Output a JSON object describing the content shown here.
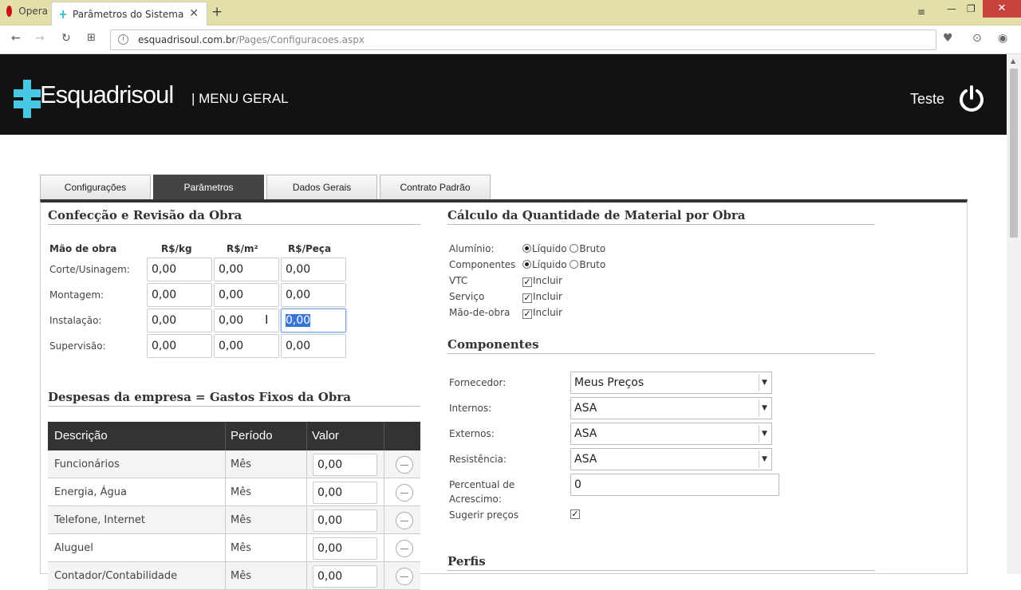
{
  "browser": {
    "opera_label": "Opera",
    "tab_title": "Parâmetros do Sistema",
    "url_host": "esquadrisoul.com.br",
    "url_path": "/Pages/Configuracoes.aspx"
  },
  "header": {
    "logo": "Esquadrisoul",
    "menu": "| MENU GERAL",
    "user": "Teste"
  },
  "tabs": [
    "Configurações",
    "Parâmetros",
    "Dados Gerais",
    "Contrato Padrão"
  ],
  "confeccao": {
    "title": "Confecção e Revisão da Obra",
    "col_labor": "Mão de obra",
    "col_kg": "R$/kg",
    "col_m2": "R$/m²",
    "col_peca": "R$/Peça",
    "rows": [
      {
        "label": "Corte/Usinagem:",
        "kg": "0,00",
        "m2": "0,00",
        "peca": "0,00"
      },
      {
        "label": "Montagem:",
        "kg": "0,00",
        "m2": "0,00",
        "peca": "0,00"
      },
      {
        "label": "Instalação:",
        "kg": "0,00",
        "m2": "0,00",
        "peca": "0,00"
      },
      {
        "label": "Supervisão:",
        "kg": "0,00",
        "m2": "0,00",
        "peca": "0,00"
      }
    ]
  },
  "despesas": {
    "title": "Despesas da empresa = Gastos Fixos da Obra",
    "headers": {
      "desc": "Descrição",
      "periodo": "Período",
      "valor": "Valor"
    },
    "rows": [
      {
        "desc": "Funcionários",
        "periodo": "Mês",
        "valor": "0,00"
      },
      {
        "desc": "Energia, Água",
        "periodo": "Mês",
        "valor": "0,00"
      },
      {
        "desc": "Telefone, Internet",
        "periodo": "Mês",
        "valor": "0,00"
      },
      {
        "desc": "Aluguel",
        "periodo": "Mês",
        "valor": "0,00"
      },
      {
        "desc": "Contador/Contabilidade",
        "periodo": "Mês",
        "valor": "0,00"
      }
    ]
  },
  "calculo": {
    "title": "Cálculo da Quantidade de Material por Obra",
    "liquido": "Líquido",
    "bruto": "Bruto",
    "incluir": "Incluir",
    "aluminio": "Alumínio:",
    "componentes": "Componentes",
    "vtc": "VTC",
    "servico": "Serviço",
    "mao_obra": "Mão-de-obra"
  },
  "componentes": {
    "title": "Componentes",
    "fornecedor_label": "Fornecedor:",
    "fornecedor": "Meus Preços",
    "internos_label": "Internos:",
    "internos": "ASA",
    "externos_label": "Externos:",
    "externos": "ASA",
    "resistencia_label": "Resistência:",
    "resistencia": "ASA",
    "percentual_label_1": "Percentual de",
    "percentual_label_2": "Acrescimo:",
    "percentual": "0",
    "sugerir_label": "Sugerir preços"
  },
  "perfis": {
    "title": "Perfis"
  }
}
